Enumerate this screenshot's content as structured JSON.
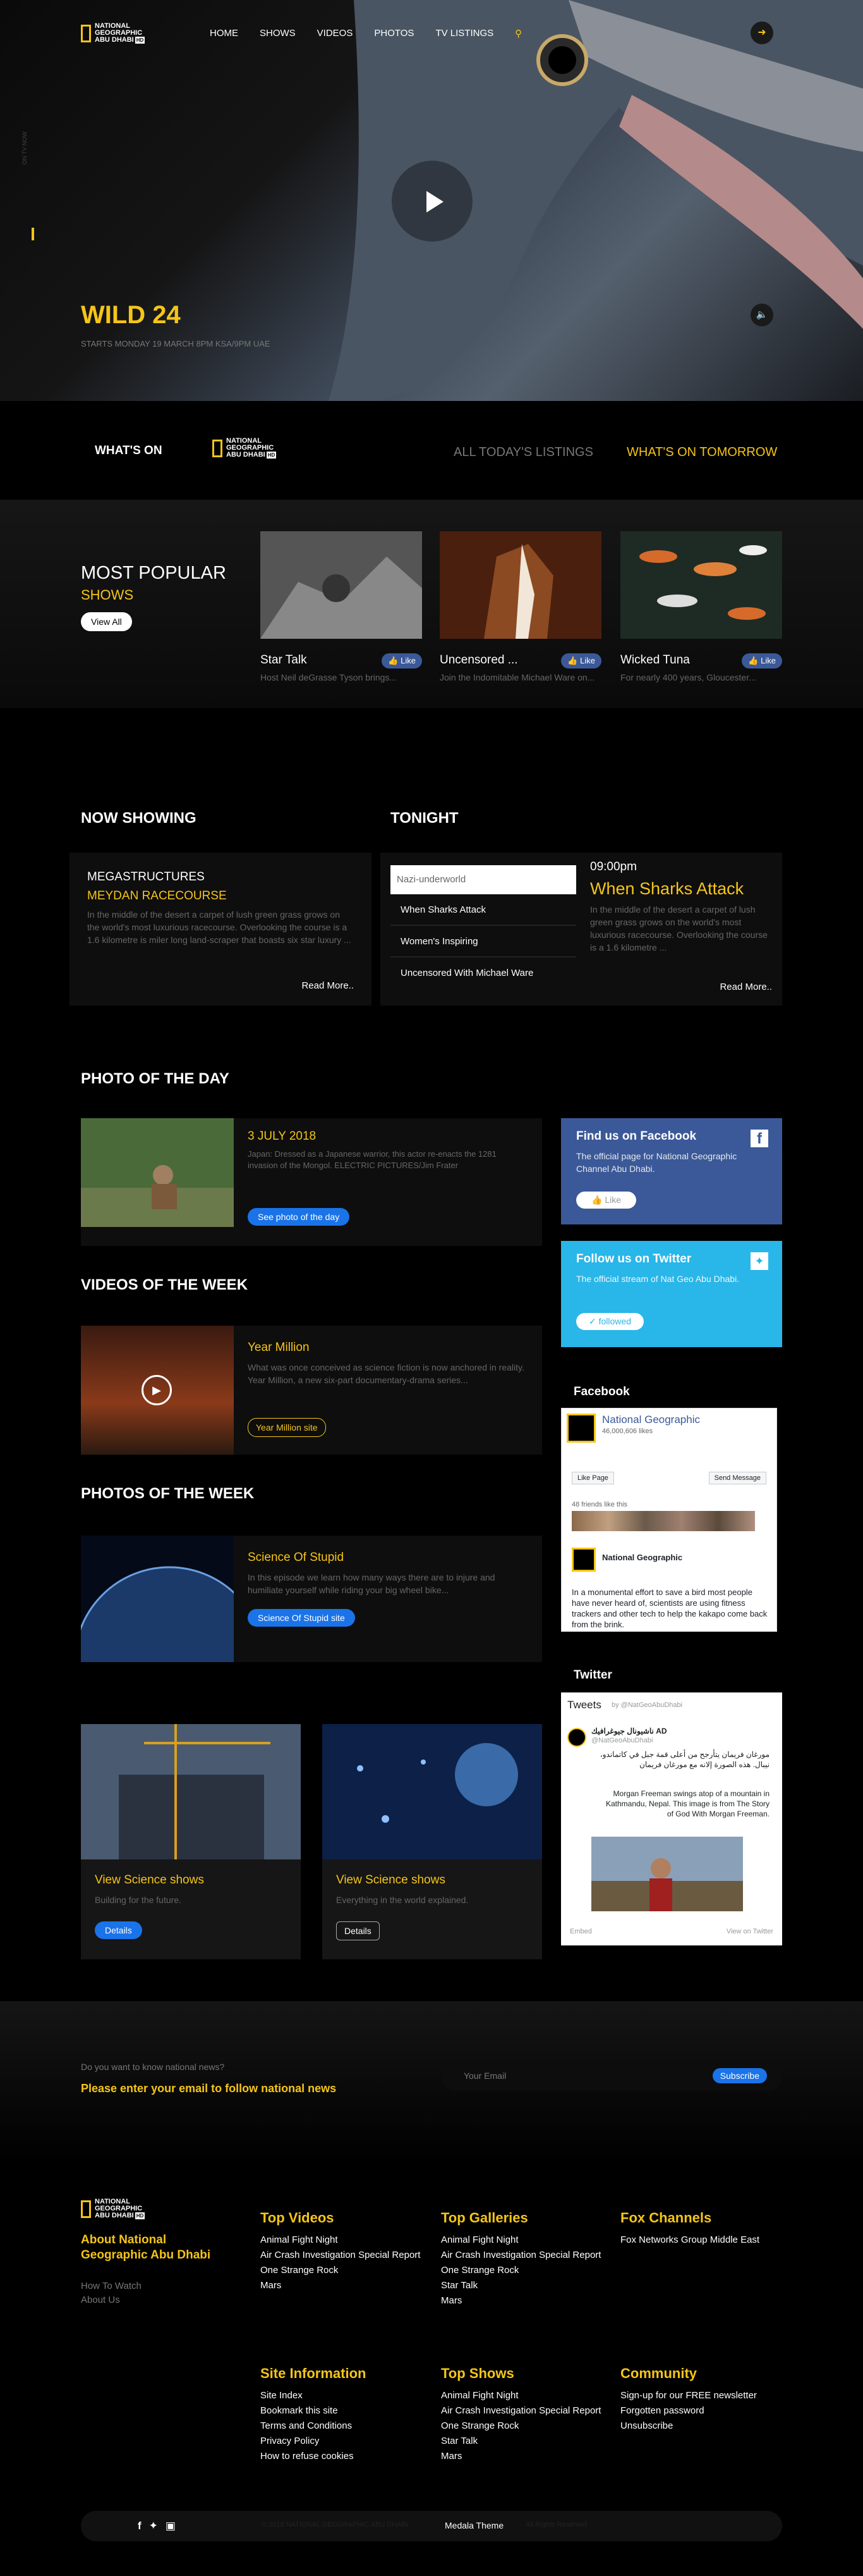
{
  "header": {
    "logo": [
      "NATIONAL",
      "GEOGRAPHIC",
      "ABU DHABI"
    ],
    "logo_hd": "HD",
    "nav": [
      "HOME",
      "SHOWS",
      "VIDEOS",
      "PHOTOS",
      "TV LISTINGS"
    ]
  },
  "hero": {
    "title": "WILD 24",
    "subtitle": "STARTS MONDAY 19 MARCH 8PM KSA/9PM UAE",
    "side_text": "ON TV NOW"
  },
  "whatson": {
    "label": "WHAT'S ON",
    "all": "ALL TODAY'S LISTINGS",
    "tomorrow": "WHAT'S ON TOMORROW"
  },
  "popular": {
    "title": "MOST POPULAR",
    "subtitle": "SHOWS",
    "view_all": "View All",
    "like": "Like",
    "shows": [
      {
        "title": "Star Talk",
        "desc": "Host Neil deGrasse Tyson brings..."
      },
      {
        "title": "Uncensored ...",
        "desc": "Join the Indomitable Michael Ware on..."
      },
      {
        "title": "Wicked Tuna",
        "desc": "For nearly 400 years, Gloucester..."
      }
    ]
  },
  "now_showing": {
    "title": "NOW SHOWING",
    "show": "MEGASTRUCTURES",
    "episode": "MEYDAN RACECOURSE",
    "desc": "In the middle of the desert a carpet of lush green grass grows on the world's most luxurious racecourse. Overlooking the course is a 1.6 kilometre is miler long land-scraper that boasts six star luxury ...",
    "read_more": "Read More.."
  },
  "tonight": {
    "title": "TONIGHT",
    "list": [
      "Nazi-underworld",
      "When Sharks Attack",
      "Women's Inspiring",
      "Uncensored With Michael Ware"
    ],
    "time": "09:00pm",
    "show": "When Sharks Attack",
    "desc": "In the middle of the desert a carpet of lush green grass grows on the world's most luxurious racecourse. Overlooking the course is a 1.6 kilometre ...",
    "read_more": "Read More.."
  },
  "photo_day": {
    "title": "PHOTO OF THE DAY",
    "date": "3 JULY 2018",
    "desc": "Japan: Dressed as a Japanese warrior, this actor re-enacts the 1281 invasion of the Mongol. ELECTRIC PICTURES/Jim Frater",
    "button": "See photo of the day"
  },
  "videos_week": {
    "title": "VIDEOS OF THE WEEK",
    "show": "Year Million",
    "desc": "What was once conceived as science fiction is now anchored in reality. Year Million, a new six-part documentary-drama series...",
    "button": "Year Million site"
  },
  "photos_week": {
    "title": "PHOTOS OF THE WEEK",
    "show": "Science Of Stupid",
    "desc": "In this episode we learn how many ways there are to injure and humiliate yourself while riding your big wheel bike...",
    "button": "Science Of Stupid site"
  },
  "science": [
    {
      "title": "View Science shows",
      "desc": "Building for the future.",
      "button": "Details"
    },
    {
      "title": "View Science shows",
      "desc": "Everything in the world explained.",
      "button": "Details"
    }
  ],
  "fb_card": {
    "title": "Find us on Facebook",
    "desc": "The official page for National Geographic Channel Abu Dhabi.",
    "button": "Like"
  },
  "tw_card": {
    "title": "Follow us on Twitter",
    "desc": "The official stream of Nat Geo Abu Dhabi.",
    "button": "followed"
  },
  "fb_widget": {
    "heading": "Facebook",
    "page": "National Geographic",
    "likes": "46,000,606 likes",
    "like_page": "Like Page",
    "send": "Send Message",
    "friends": "48 friends like this",
    "post_author": "National Geographic",
    "post_text": "In a monumental effort to save a bird most people have never heard of, scientists are using fitness trackers and other tech to help the kakapo come back from the brink."
  },
  "tw_widget": {
    "heading": "Twitter",
    "title": "Tweets",
    "by": "by @NatGeoAbuDhabi",
    "name": "ناشيونال جيوغرافيك AD",
    "handle": "@NatGeoAbuDhabi",
    "arabic": "مورغان فريمان يتأرجح من أعلى قمة جبل في كاتماندو، نيبال. هذه الصورة إلانه مع مورغان فريمان",
    "tweet": "Morgan Freeman swings atop of a mountain in Kathmandu, Nepal. This image is from The Story of God With Morgan Freeman.",
    "embed": "Embed",
    "view": "View on Twitter"
  },
  "newsletter": {
    "question": "Do you want to know national news?",
    "prompt": "Please enter your email to follow national news",
    "placeholder": "Your Email",
    "button": "Subscribe"
  },
  "footer": {
    "about": "About National Geographic Abu Dhabi",
    "about_links": [
      "How To Watch",
      "About Us"
    ],
    "cols": [
      {
        "title": "Top Videos",
        "items": [
          "Animal Fight Night",
          "Air Crash Investigation Special Report",
          "One Strange Rock",
          "Mars"
        ]
      },
      {
        "title": "Top Galleries",
        "items": [
          "Animal Fight Night",
          "Air Crash Investigation Special Report",
          "One Strange Rock",
          "Star Talk",
          "Mars"
        ]
      },
      {
        "title": "Fox Channels",
        "items": [
          "Fox Networks Group Middle East"
        ]
      },
      {
        "title": "Site Information",
        "items": [
          "Site Index",
          "Bookmark this site",
          "Terms and Conditions",
          "Privacy Policy",
          "How to refuse cookies"
        ]
      },
      {
        "title": "Top Shows",
        "items": [
          "Animal Fight Night",
          "Air Crash Investigation Special Report",
          "One Strange Rock",
          "Star Talk",
          "Mars"
        ]
      },
      {
        "title": "Community",
        "items": [
          "Sign-up for our FREE newsletter",
          "Forgotten password",
          "Unsubscribe"
        ]
      }
    ],
    "copyright": "© 2018 NATIONAL GEOGRAPHIC ABU DHABI",
    "theme": "Medala Theme",
    "rights": "All Rights Reserved"
  },
  "colors": {
    "accent": "#f5c518",
    "blue": "#1a73e8",
    "facebook": "#3b5998",
    "twitter": "#1da1f2"
  }
}
